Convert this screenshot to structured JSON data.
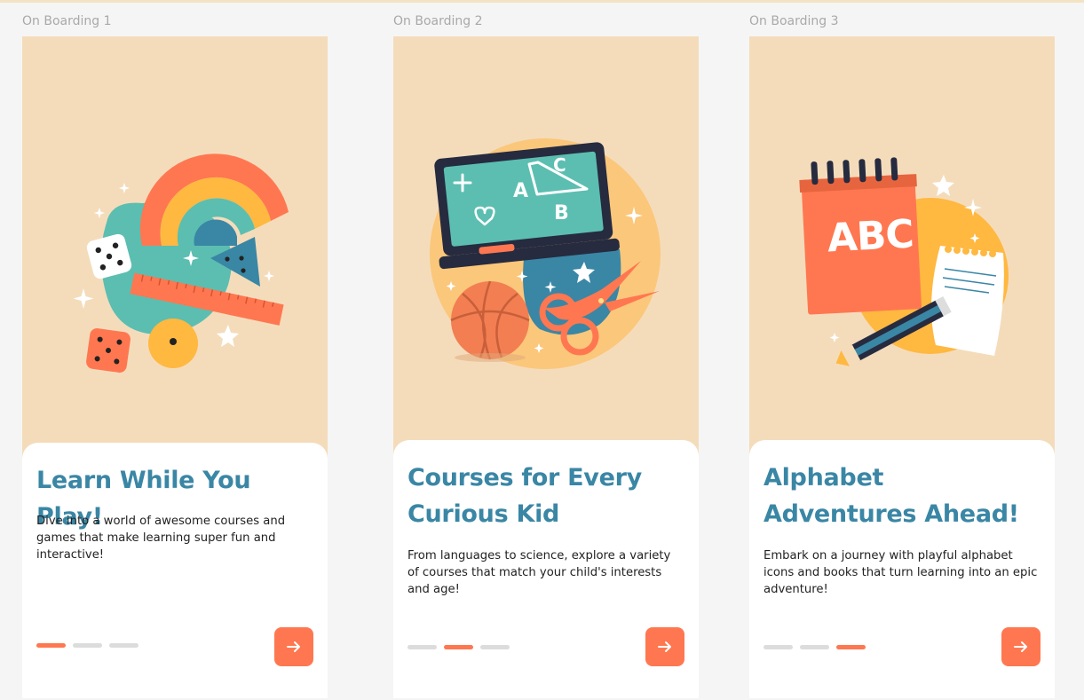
{
  "colors": {
    "background": "#f5f5f5",
    "screen_bg": "#f4dcbb",
    "title": "#3a86a5",
    "accent": "#ff7750",
    "dot_inactive": "#dcdcdc"
  },
  "screens": [
    {
      "frame_label": "On Boarding 1",
      "illustration": "rainbow-dice-ruler-illustration",
      "title": "Learn While You Play!",
      "description": "Dive into a world of awesome courses and games that make learning super fun and interactive!",
      "active_page": 1,
      "page_count": 3,
      "next_icon": "arrow-right-icon"
    },
    {
      "frame_label": "On Boarding 2",
      "illustration": "chalkboard-basketball-scissors-illustration",
      "chalkboard_marks": [
        "+",
        "A",
        "C",
        "B"
      ],
      "title": "Courses for Every Curious Kid",
      "description": "From languages to science, explore a variety of courses that match your child's interests and age!",
      "active_page": 2,
      "page_count": 3,
      "next_icon": "arrow-right-icon"
    },
    {
      "frame_label": "On Boarding 3",
      "illustration": "abc-notepad-pencil-illustration",
      "notepad_text": "ABC",
      "title": "Alphabet Adventures Ahead!",
      "description": "Embark on a journey with playful alphabet icons and books that turn learning into an epic adventure!",
      "active_page": 3,
      "page_count": 3,
      "next_icon": "arrow-right-icon"
    }
  ]
}
